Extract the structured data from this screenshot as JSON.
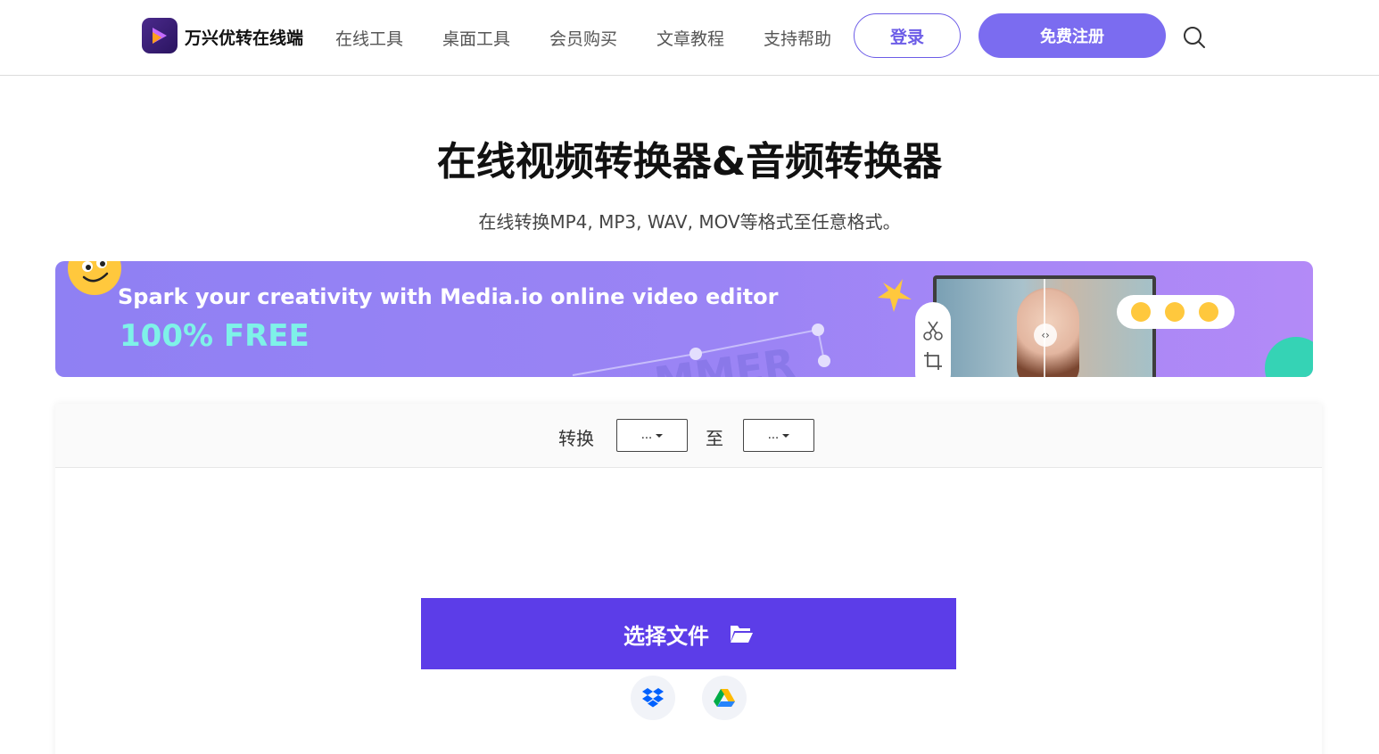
{
  "header": {
    "brand": "万兴优转在线端",
    "nav": [
      "在线工具",
      "桌面工具",
      "会员购买",
      "文章教程",
      "支持帮助"
    ],
    "login": "登录",
    "signup": "免费注册"
  },
  "hero": {
    "title": "在线视频转换器&音频转换器",
    "subtitle": "在线转换MP4, MP3, WAV, MOV等格式至任意格式。"
  },
  "banner": {
    "text": "Spark your creativity with Media.io online video editor",
    "free": "100% FREE",
    "deco_text": "MMER"
  },
  "converter": {
    "convert_label": "转换",
    "from_value": "...",
    "to_label": "至",
    "to_value": "...",
    "choose_file": "选择文件"
  },
  "colors": {
    "accent": "#5c3de8",
    "signup": "#7b6cf0",
    "free_text": "#7ef2e8"
  },
  "icons": [
    "logo-icon",
    "search-icon",
    "scissors-icon",
    "crop-icon",
    "folder-icon",
    "dropbox-icon",
    "google-drive-icon"
  ]
}
